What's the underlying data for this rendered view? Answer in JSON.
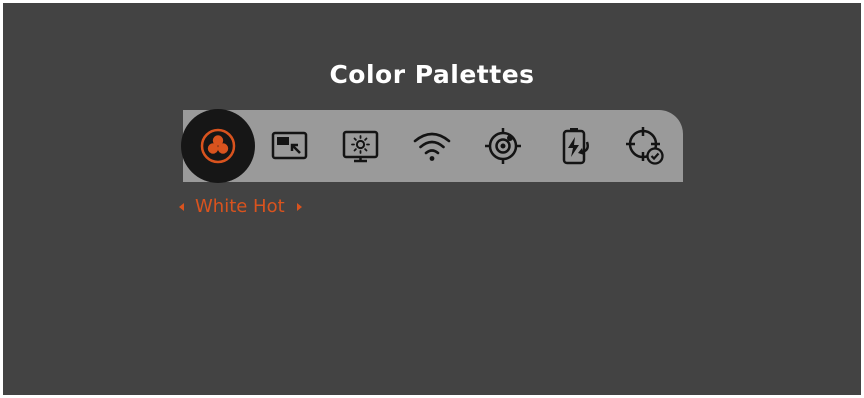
{
  "title": "Color Palettes",
  "menu": {
    "items": [
      {
        "icon": "color-palette-icon",
        "selected": true
      },
      {
        "icon": "picture-in-picture-icon",
        "selected": false
      },
      {
        "icon": "screen-brightness-icon",
        "selected": false
      },
      {
        "icon": "wifi-icon",
        "selected": false
      },
      {
        "icon": "target-lock-icon",
        "selected": false
      },
      {
        "icon": "battery-charging-icon",
        "selected": false
      },
      {
        "icon": "crosshair-calibrate-icon",
        "selected": false
      }
    ]
  },
  "option": {
    "value": "White Hot"
  },
  "colors": {
    "background": "#434343",
    "menu_bar": "#9a9a9a",
    "selected_circle": "#161616",
    "accent": "#d9531e",
    "title_text": "#ffffff"
  }
}
